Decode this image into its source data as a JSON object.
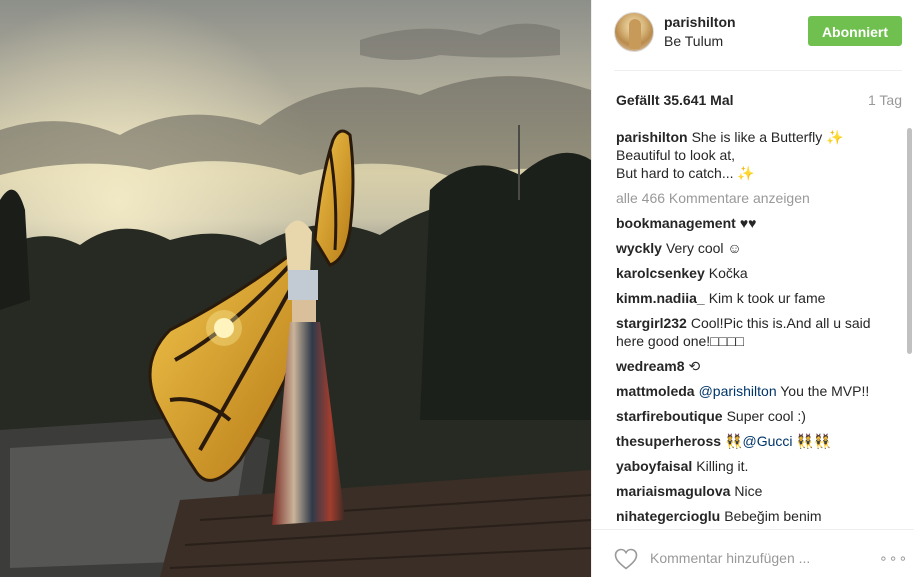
{
  "post": {
    "username": "parishilton",
    "location": "Be Tulum",
    "follow_label": "Abonniert",
    "likes": "Gefällt 35.641 Mal",
    "time": "1 Tag",
    "caption": {
      "user": "parishilton",
      "line1": "She is like a Butterfly ✨",
      "line2": "Beautiful to look at,",
      "line3": "But hard to catch... ✨"
    },
    "view_all": "alle 466 Kommentare anzeigen",
    "comments": [
      {
        "user": "bookmanagement",
        "text": "♥♥"
      },
      {
        "user": "wyckly",
        "text": "Very cool ☺"
      },
      {
        "user": "karolcsenkey",
        "text": "Kočka"
      },
      {
        "user": "kimm.nadiia_",
        "text": "Kim k took ur fame"
      },
      {
        "user": "stargirl232",
        "text": "Cool!Pic this is.And all u said here good one!□□□□"
      },
      {
        "user": "wedream8",
        "text": "⟲"
      },
      {
        "user": "mattmoleda",
        "mention": "@parishilton",
        "text": "You the MVP!!"
      },
      {
        "user": "starfireboutique",
        "text": "Super cool :)"
      },
      {
        "user": "thesuperheross",
        "pre": "👯",
        "mention": "@Gucci",
        "text": "👯👯"
      },
      {
        "user": "yaboyfaisal",
        "text": "Killing it."
      },
      {
        "user": "mariaismagulova",
        "text": "Nice"
      },
      {
        "user": "nihategercioglu",
        "text": "Bebeğim benim"
      }
    ],
    "comment_placeholder": "Kommentar hinzufügen ...",
    "more_label": "∘∘∘"
  },
  "colors": {
    "follow_button": "#70c050",
    "mention": "#003569",
    "muted": "#999999"
  },
  "icons": {
    "like": "heart-icon",
    "more": "more-options-icon"
  }
}
